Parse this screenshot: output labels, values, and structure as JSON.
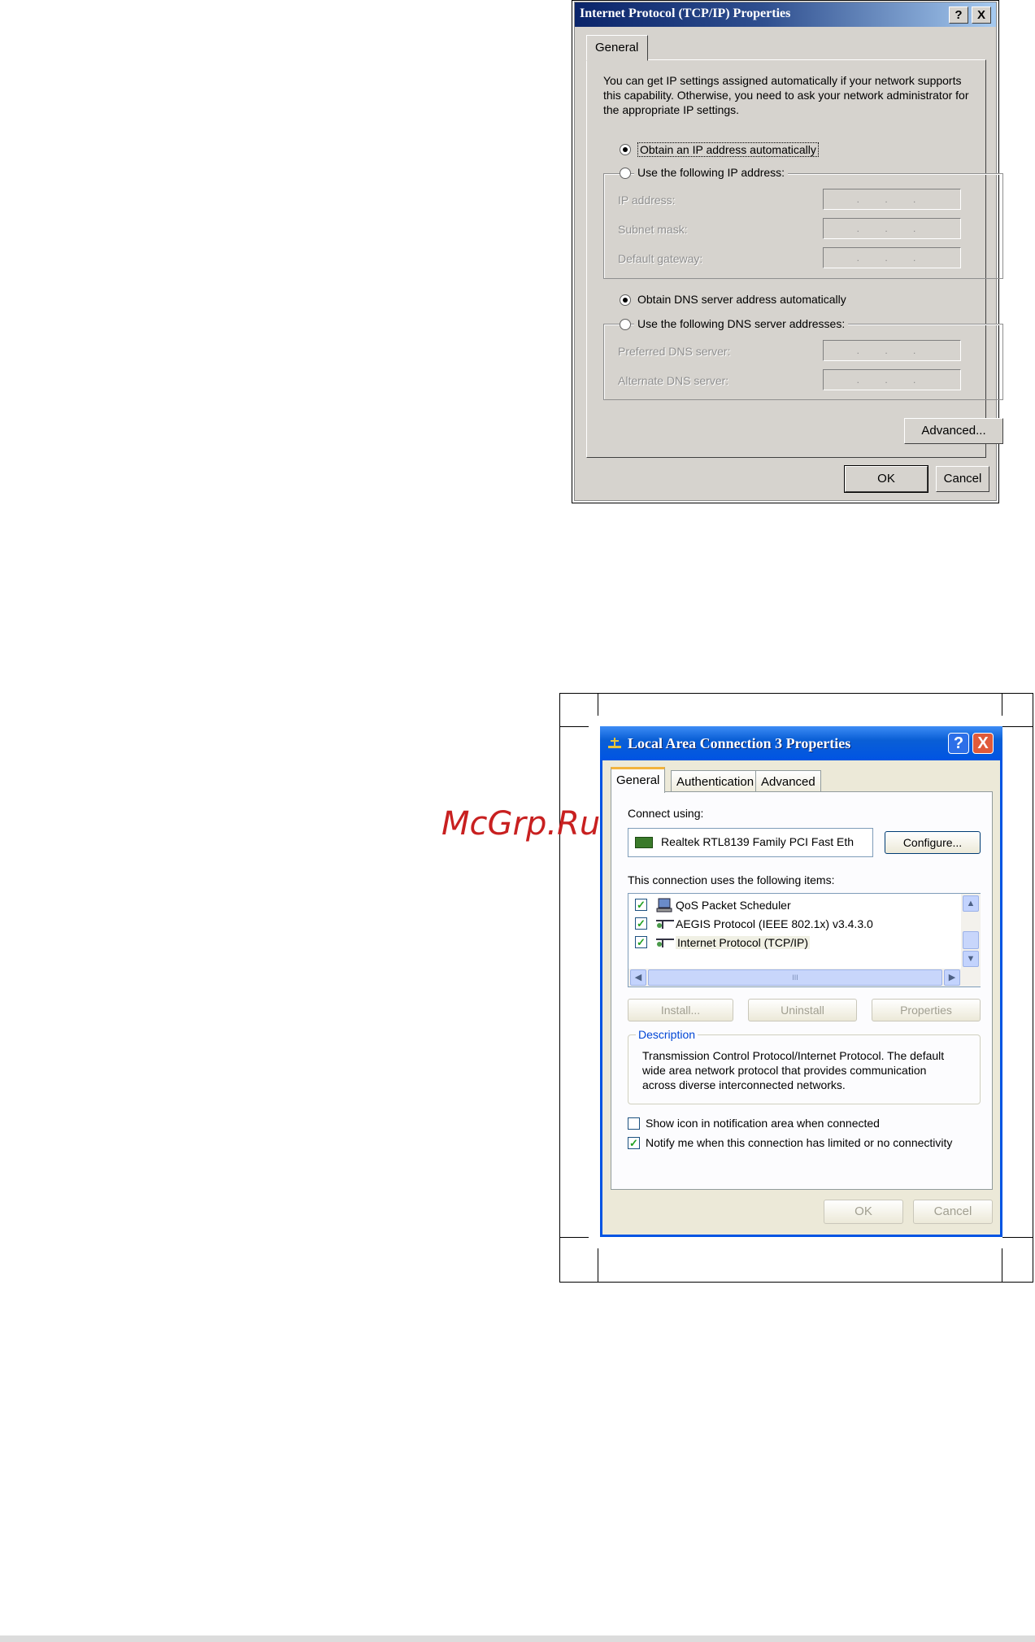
{
  "tcpip_dialog": {
    "title": "Internet Protocol (TCP/IP) Properties",
    "help_glyph": "?",
    "close_glyph": "X",
    "tab": "General",
    "intro_line1": "You can get IP settings assigned automatically if your network supports",
    "intro_line2": "this capability. Otherwise, you need to ask your network administrator for",
    "intro_line3": "the appropriate IP settings.",
    "radio_obtain_ip": "Obtain an IP address automatically",
    "radio_use_ip": "Use the following IP address:",
    "ip_address_label": "IP address:",
    "subnet_mask_label": "Subnet mask:",
    "default_gateway_label": "Default gateway:",
    "ip_placeholder": ". . .",
    "radio_obtain_dns": "Obtain DNS server address automatically",
    "radio_use_dns": "Use the following DNS server addresses:",
    "preferred_dns_label": "Preferred DNS server:",
    "alternate_dns_label": "Alternate DNS server:",
    "advanced_button": "Advanced...",
    "ok_button": "OK",
    "cancel_button": "Cancel"
  },
  "lan_dialog": {
    "title": "Local Area Connection 3 Properties",
    "help_glyph": "?",
    "close_glyph": "X",
    "tabs": [
      "General",
      "Authentication",
      "Advanced"
    ],
    "connect_using_label": "Connect using:",
    "adapter_name": "Realtek RTL8139 Family PCI Fast Eth",
    "configure_button": "Configure...",
    "items_label": "This connection uses the following items:",
    "items": [
      "QoS Packet Scheduler",
      "AEGIS Protocol (IEEE 802.1x) v3.4.3.0",
      "Internet Protocol (TCP/IP)"
    ],
    "scroll_thumb": "III",
    "install_button": "Install...",
    "uninstall_button": "Uninstall",
    "properties_button": "Properties",
    "description_legend": "Description",
    "description_line1": "Transmission Control Protocol/Internet Protocol. The default",
    "description_line2": "wide area network protocol that provides communication",
    "description_line3": "across diverse interconnected networks.",
    "show_icon_label": "Show icon in notification area when connected",
    "notify_label": "Notify me when this connection has limited or no connectivity",
    "check_mark": "✓",
    "ok_button": "OK",
    "cancel_button": "Cancel"
  },
  "watermark": "McGrp.Ru"
}
